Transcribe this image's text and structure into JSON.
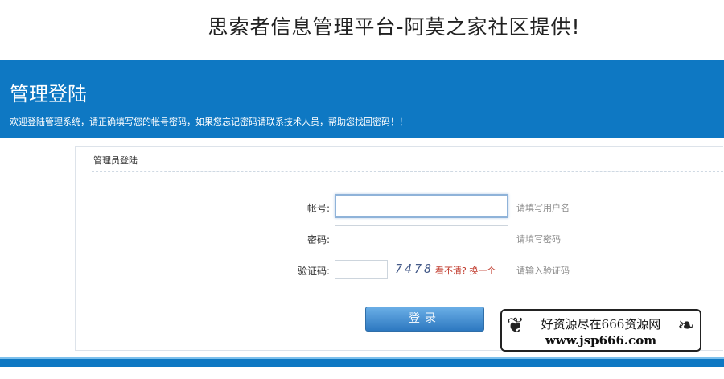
{
  "page_title": "思索者信息管理平台-阿莫之家社区提供!",
  "header": {
    "title": "管理登陆",
    "welcome": "欢迎登陆管理系统，请正确填写您的帐号密码，如果您忘记密码请联系技术人员，帮助您找回密码！！"
  },
  "panel": {
    "title": "管理员登陆",
    "account_label": "帐号:",
    "account_value": "",
    "account_hint": "请填写用户名",
    "password_label": "密码:",
    "password_value": "",
    "password_hint": "请填写密码",
    "captcha_label": "验证码:",
    "captcha_value": "",
    "captcha_code": "7478",
    "captcha_refresh": "看不清? 换一个",
    "captcha_hint": "请输入验证码",
    "login_label": "登录"
  },
  "watermark": {
    "line1": "好资源尽在666资源网",
    "line2": "www.jsp666.com"
  },
  "colors": {
    "brand_blue": "#0e78c3",
    "button_blue": "#2d78c0",
    "refresh_red": "#c0392b"
  }
}
